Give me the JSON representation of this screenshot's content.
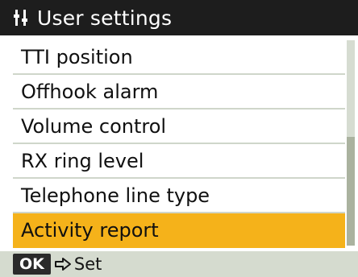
{
  "header": {
    "title": "User settings",
    "icon": "settings-sliders-icon"
  },
  "menu": {
    "items": [
      {
        "label": "TTI position",
        "selected": false
      },
      {
        "label": "Offhook alarm",
        "selected": false
      },
      {
        "label": "Volume control",
        "selected": false
      },
      {
        "label": "RX ring level",
        "selected": false
      },
      {
        "label": "Telephone line type",
        "selected": false
      },
      {
        "label": "Activity report",
        "selected": true
      }
    ]
  },
  "footer": {
    "ok_label": "OK",
    "action_label": "Set",
    "arrow_icon": "arrow-right-icon"
  },
  "colors": {
    "header_bg": "#1d1d1d",
    "selected_bg": "#f5b21a",
    "footer_bg": "#d5dbcf"
  }
}
